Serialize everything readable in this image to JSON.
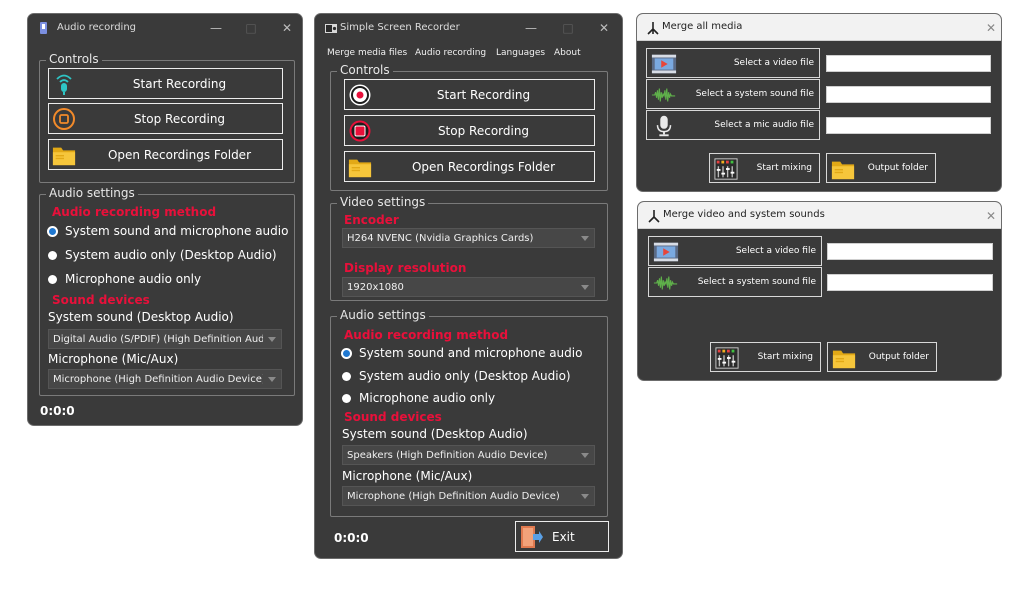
{
  "audio_win": {
    "title": "Audio recording",
    "controls_title": "Controls",
    "start_label": "Start Recording",
    "stop_label": "Stop Recording",
    "open_label": "Open Recordings Folder",
    "audio_settings_title": "Audio settings",
    "method_heading": "Audio recording method",
    "options": [
      "System sound and microphone audio",
      "System audio only (Desktop Audio)",
      "Microphone audio only"
    ],
    "selected_option": 0,
    "sound_devices_heading": "Sound devices",
    "system_sound_label": "System sound (Desktop Audio)",
    "system_sound_value": "Digital Audio (S/PDIF) (High Definition Audi...",
    "mic_label": "Microphone (Mic/Aux)",
    "mic_value": "Microphone (High Definition Audio Device)",
    "timer": "0:0:0"
  },
  "main_win": {
    "title": "Simple Screen Recorder",
    "menu": [
      "Merge media files",
      "Audio recording",
      "Languages",
      "About"
    ],
    "controls_title": "Controls",
    "start_label": "Start Recording",
    "stop_label": "Stop Recording",
    "open_label": "Open Recordings Folder",
    "video_settings_title": "Video settings",
    "encoder_heading": "Encoder",
    "encoder_value": "H264 NVENC (Nvidia Graphics Cards)",
    "resolution_heading": "Display resolution",
    "resolution_value": "1920x1080",
    "audio_settings_title": "Audio settings",
    "method_heading": "Audio recording method",
    "options": [
      "System sound and microphone audio",
      "System audio only (Desktop Audio)",
      "Microphone audio only"
    ],
    "selected_option": 0,
    "sound_devices_heading": "Sound devices",
    "system_sound_label": "System sound (Desktop Audio)",
    "system_sound_value": "Speakers (High Definition Audio Device)",
    "mic_label": "Microphone (Mic/Aux)",
    "mic_value": "Microphone (High Definition Audio Device)",
    "timer": "0:0:0",
    "exit_label": "Exit"
  },
  "merge_all_win": {
    "title": "Merge all media",
    "video_label": "Select a video file",
    "sound_label": "Select a system sound file",
    "mic_label": "Select a mic audio file",
    "video_value": "",
    "sound_value": "",
    "mic_value": "",
    "start_mixing_label": "Start mixing",
    "output_folder_label": "Output folder"
  },
  "merge_vs_win": {
    "title": "Merge video and system sounds",
    "video_label": "Select a video file",
    "sound_label": "Select a system sound file",
    "video_value": "",
    "sound_value": "",
    "start_mixing_label": "Start mixing",
    "output_folder_label": "Output folder"
  },
  "colors": {
    "window_bg": "#3a3a3a",
    "accent_red": "#e8103a",
    "radio_selected": "#1f78d1"
  }
}
